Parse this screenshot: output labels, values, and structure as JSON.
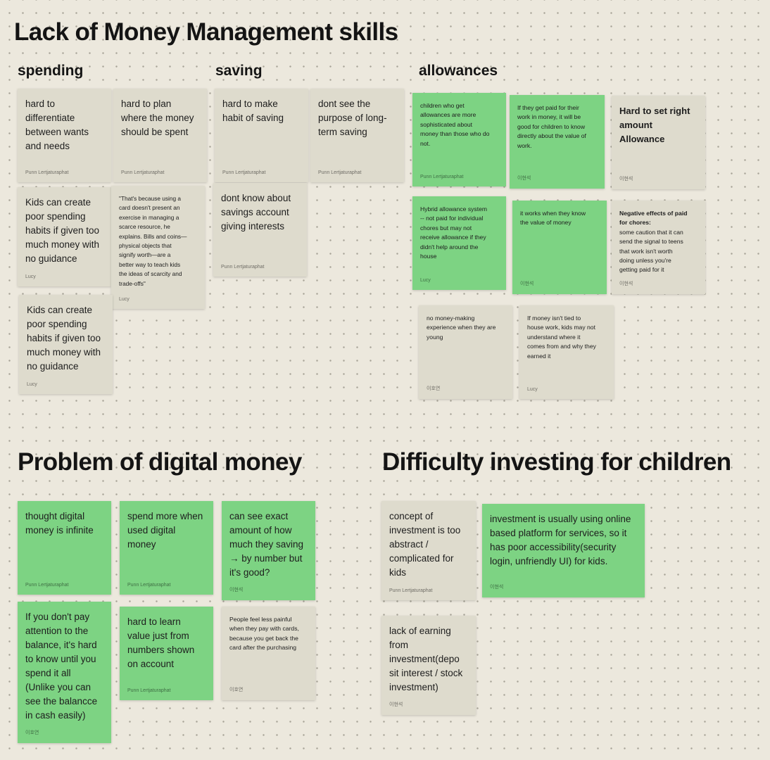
{
  "title": "Lack of Money Management skills",
  "sections": {
    "spending": "spending",
    "saving": "saving",
    "allowances": "allowances",
    "digital": "Problem of digital money",
    "investing": "Difficulty investing for children"
  },
  "notes": {
    "sp1": {
      "text": "hard to\ndifferentiate\nbetween wants\nand needs",
      "author": "Punn Lertjaturaphat"
    },
    "sp2": {
      "text": "hard to plan\nwhere the money\nshould be spent",
      "author": "Punn Lertjaturaphat"
    },
    "sp3": {
      "text": "Kids can create\npoor spending\nhabits if given too\nmuch money with\nno guidance",
      "author": "Lucy"
    },
    "sp4": {
      "text": "\"That's because using a\ncard doesn't present an\nexercise in managing a\nscarce resource, he\nexplains. Bills and coins—\nphysical objects that\nsignify worth—are a\nbetter way to teach kids\nthe ideas of scarcity and\ntrade-offs\"",
      "author": "Lucy"
    },
    "sp5": {
      "text": "Kids can create\npoor spending\nhabits if given too\nmuch money with\nno guidance",
      "author": "Lucy"
    },
    "sv1": {
      "text": "hard to make\nhabit of saving",
      "author": "Punn Lertjaturaphat"
    },
    "sv2": {
      "text": "dont see the\npurpose of long-\nterm saving",
      "author": "Punn Lertjaturaphat"
    },
    "sv3": {
      "text": "dont know about\nsavings account\ngiving interests",
      "author": "Punn Lertjaturaphat"
    },
    "al1": {
      "text": "children who get\nallowances are more\nsophisticated about\nmoney than those who do\nnot.",
      "author": "Punn Lertjaturaphat"
    },
    "al2": {
      "text": "If they get paid for their\nwork in money, it will be\ngood for children to know\ndirectly about the value of\nwork.",
      "author": "이현석"
    },
    "al3": {
      "text": "Hard to set right\namount\nAllowance",
      "author": "이현석"
    },
    "al4": {
      "text": "Hybrid allowance system\n-- not paid for individual\nchores but may not\nreceive allowance if they\ndidn't help around the\nhouse",
      "author": "Lucy"
    },
    "al5": {
      "text": "it works when they know\nthe value of money",
      "author": "이현석"
    },
    "al6": {
      "title": "Negative effects of paid\nfor chores:",
      "text": "some caution that it can\nsend the signal to teens\nthat work isn't worth\ndoing unless you're\ngetting paid for it",
      "author": "이현석"
    },
    "al7": {
      "text": "no money-making\nexperience when they are\nyoung",
      "author": "이호연"
    },
    "al8": {
      "text": "If money isn't tied to\nhouse work, kids may not\nunderstand where it\ncomes from and why they\nearned it",
      "author": "Lucy"
    },
    "dg1": {
      "text": "thought digital\nmoney is infinite",
      "author": "Punn Lertjaturaphat"
    },
    "dg2": {
      "text": "spend more when\nused digital\nmoney",
      "author": "Punn Lertjaturaphat"
    },
    "dg3": {
      "text": "can see exact\namount of how\nmuch they saving\n→ by number but\nit's good?",
      "author": "이현석"
    },
    "dg4": {
      "text": "If you don't pay\nattention to the\nbalance, it's hard\nto know until you\nspend it all\n(Unlike you can\nsee the balancce\nin cash easily)",
      "author": "이호연"
    },
    "dg5": {
      "text": "hard to learn\nvalue just from\nnumbers shown\non account",
      "author": "Punn Lertjaturaphat"
    },
    "dg6": {
      "text": "People feel less painful\nwhen they pay with cards,\nbecause you get back the\ncard after the purchasing",
      "author": "이호연"
    },
    "iv1": {
      "text": "concept of\ninvestment is too\nabstract /\ncomplicated for\nkids",
      "author": "Punn Lertjaturaphat"
    },
    "iv2": {
      "text": "investment is usually using online\nbased platform for services, so it\nhas poor accessibility(security\nlogin, unfriendly UI) for kids.",
      "author": "이현석"
    },
    "iv3": {
      "text": "lack of earning\nfrom\ninvestment(depo\nsit interest / stock\ninvestment)",
      "author": "이현석"
    }
  },
  "colors": {
    "background": "#ece8dd",
    "tan_note": "#dedbcd",
    "green_note": "#7dd383"
  }
}
